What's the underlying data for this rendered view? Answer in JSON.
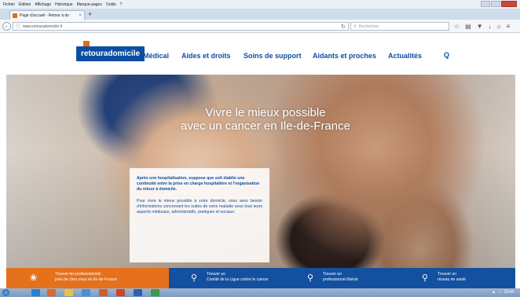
{
  "browser": {
    "menu": [
      "Fichier",
      "Édition",
      "Affichage",
      "Historique",
      "Marque-pages",
      "Outils",
      "?"
    ],
    "tab_title": "Page d'accueil - Retour à do",
    "tab_close": "×",
    "new_tab": "+",
    "url": "www.retouradomicile.fr",
    "search_placeholder": "Rechercher"
  },
  "site": {
    "logo": "retouradomicile",
    "nav": [
      "Médical",
      "Aides et droits",
      "Soins de support",
      "Aidants et proches",
      "Actualités"
    ],
    "search_icon": "Q"
  },
  "hero": {
    "title_line1": "Vivre le mieux possible",
    "title_line2": "avec un cancer en Ile-de-France",
    "card_strong": "Après une hospitalisation, suppose que soit établie une continuité entre la prise en charge hospitalière et l'organisation du retour à domicile.",
    "card_body": "Pour vivre le mieux possible à votre domicile, vous avez besoin d'informations concernant les suites de votre maladie sous tous leurs aspects médicaux, administratifs, pratiques et sociaux."
  },
  "bottom_bar": [
    {
      "line1": "Trouver les professionnels",
      "line2": "près de chez vous en Ile-de-France",
      "icon": "hands-icon"
    },
    {
      "line1": "Trouver un",
      "line2": "Comité de la Ligue contre le cancer",
      "icon": "map-pin-icon"
    },
    {
      "line1": "Trouver un",
      "line2": "professionnel libéral",
      "icon": "map-pin-icon"
    },
    {
      "line1": "Trouver un",
      "line2": "réseau de santé",
      "icon": "map-pin-icon"
    }
  ],
  "taskbar": {
    "time": "13:44"
  },
  "colors": {
    "brand_blue": "#0d4ea2",
    "brand_orange": "#e5711c",
    "bar_blue": "#1450a0"
  }
}
